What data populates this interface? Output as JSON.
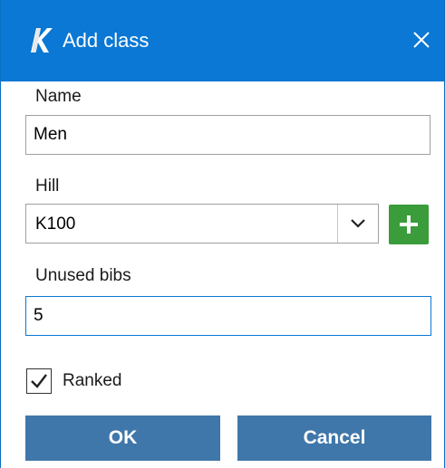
{
  "window": {
    "title": "Add class"
  },
  "fields": {
    "name": {
      "label": "Name",
      "value": "Men"
    },
    "hill": {
      "label": "Hill",
      "selected": "K100"
    },
    "unused_bibs": {
      "label": "Unused bibs",
      "value": "5"
    }
  },
  "ranked": {
    "label": "Ranked",
    "checked": true
  },
  "buttons": {
    "ok": "OK",
    "cancel": "Cancel"
  },
  "icons": {
    "app": "app-logo-k-icon",
    "close": "close-icon",
    "dropdown": "chevron-down-icon",
    "add": "plus-icon",
    "check": "checkmark-icon"
  },
  "colors": {
    "titlebar": "#0a78d4",
    "button": "#3f77aa",
    "add_button": "#3a9c3a",
    "focus_border": "#0a78d4"
  }
}
